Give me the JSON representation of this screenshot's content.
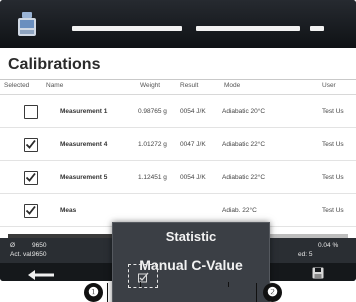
{
  "header": {
    "app_icon": "weighing-scale-icon"
  },
  "page": {
    "title": "Calibrations"
  },
  "table": {
    "columns": {
      "selected": "Selected",
      "name": "Name",
      "weight": "Weight",
      "result": "Result",
      "mode": "Mode",
      "user": "User"
    },
    "rows": [
      {
        "checked": false,
        "name": "Measurement 1",
        "weight": "0.98765 g",
        "result": "0054 J/K",
        "mode": "Adiabatic 20°C",
        "user": "Test Us"
      },
      {
        "checked": true,
        "name": "Measurement 4",
        "weight": "1.01272 g",
        "result": "0047 J/K",
        "mode": "Adiabatic 22°C",
        "user": "Test Us"
      },
      {
        "checked": true,
        "name": "Measurement 5",
        "weight": "1.12451 g",
        "result": "0054 J/K",
        "mode": "Adiabatic 22°C",
        "user": "Test Us"
      },
      {
        "checked": true,
        "name": "Meas",
        "weight": "",
        "result": "",
        "mode": "Adiab. 22°C",
        "user": "Test Us"
      }
    ]
  },
  "status": {
    "avg_label": "Ø",
    "avg_value": "9650",
    "act_label": "Act. val.",
    "act_value": "9650",
    "right_label": "ed:",
    "right_value": "0.04 %",
    "right_count": "5"
  },
  "popup": {
    "items": [
      "Statistic",
      "Manual C-Value"
    ]
  },
  "toolbar": {
    "back_icon": "back-arrow-icon",
    "edit_icon": "edit-checkbox-icon",
    "save_icon": "save-icon"
  },
  "callouts": {
    "one": "❶",
    "two": "❷"
  },
  "colors": {
    "frame": "#1b1f24",
    "popup": "#3b3f45",
    "content": "#ffffff"
  }
}
